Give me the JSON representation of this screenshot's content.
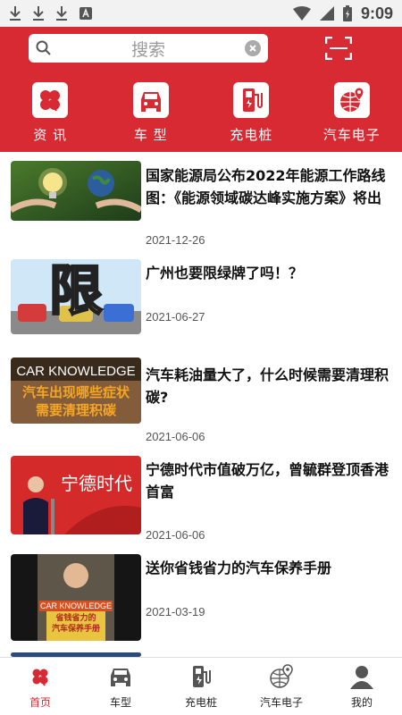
{
  "status_bar": {
    "time": "9:09"
  },
  "search": {
    "placeholder": "搜索"
  },
  "categories": [
    {
      "label": "资 讯",
      "icon": "clover-icon"
    },
    {
      "label": "车 型",
      "icon": "car-icon"
    },
    {
      "label": "充电桩",
      "icon": "charging-station-icon"
    },
    {
      "label": "汽车电子",
      "icon": "globe-location-icon"
    }
  ],
  "news": [
    {
      "title": "国家能源局公布2022年能源工作路线图：《能源领域碳达峰实施方案》将出",
      "date": "2021-12-26",
      "thumb": "light-bulb-globe"
    },
    {
      "title": "广州也要限绿牌了吗！？",
      "date": "2021-06-27",
      "thumb_text": "限"
    },
    {
      "title": "汽车耗油量大了，什么时候需要清理积碳?",
      "date": "2021-06-06",
      "thumb_text": [
        "CAR KNOWLEDGE",
        "汽车出现哪些症状",
        "需要清理积碳"
      ]
    },
    {
      "title": "宁德时代市值破万亿，曾毓群登顶香港首富",
      "date": "2021-06-06",
      "thumb_text": "宁德时代"
    },
    {
      "title": "送你省钱省力的汽车保养手册",
      "date": "2021-03-19",
      "thumb_text": [
        "CAR KNOWLEDGE",
        "省钱省力的",
        "汽车保养手册"
      ]
    }
  ],
  "bottom_nav": [
    {
      "label": "首页",
      "icon": "clover-icon",
      "active": true
    },
    {
      "label": "车型",
      "icon": "car-icon",
      "active": false
    },
    {
      "label": "充电桩",
      "icon": "charging-station-icon",
      "active": false
    },
    {
      "label": "汽车电子",
      "icon": "globe-location-icon",
      "active": false
    },
    {
      "label": "我的",
      "icon": "user-icon",
      "active": false
    }
  ],
  "colors": {
    "accent": "#d82a32",
    "status_bar": "#f2f2f2"
  }
}
